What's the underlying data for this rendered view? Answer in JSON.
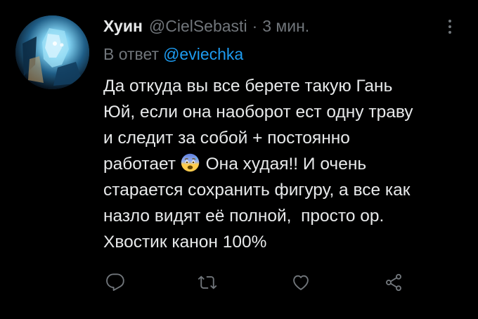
{
  "tweet": {
    "author_name": "Хуин",
    "author_handle": "@CielSebasti",
    "separator": "·",
    "time": "3 мин.",
    "reply_prefix": "В ответ",
    "reply_handle": "@eviechka",
    "body_lines": [
      "Да откуда вы все берете такую Гань",
      "Юй, если она наоборот ест одну траву",
      "и следит за собой + постоянно",
      "работает",
      "Она худая!! И очень",
      "старается сохранить фигуру, а все как",
      "назло видят её полной,  просто ор.",
      "Хвостик канон 100%"
    ],
    "emoji": "anxious-face-with-sweat"
  },
  "actions": {
    "reply_icon": "reply-icon",
    "retweet_icon": "retweet-icon",
    "like_icon": "like-icon",
    "share_icon": "share-icon"
  },
  "colors": {
    "background": "#000000",
    "text": "#e7e9ea",
    "muted": "#71767b",
    "accent": "#1d9bf0"
  }
}
